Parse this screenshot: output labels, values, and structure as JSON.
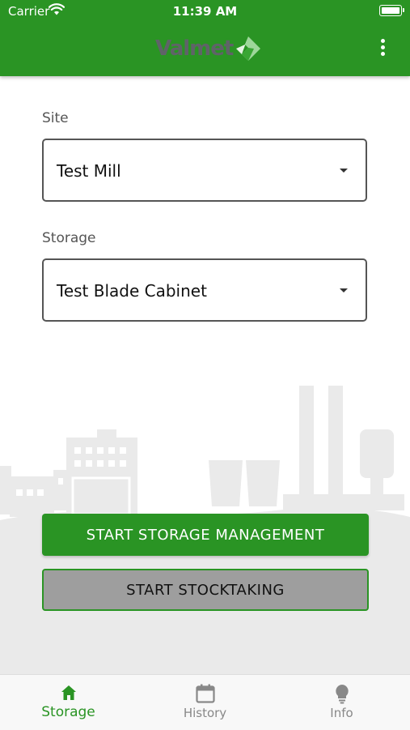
{
  "status_bar": {
    "carrier": "Carrier",
    "time": "11:39 AM",
    "icons": [
      "wifi-icon",
      "battery-icon"
    ]
  },
  "header": {
    "logo_text": "Valmet",
    "brand_color": "#2a9424",
    "menu_icon": "more-vertical-icon"
  },
  "form": {
    "site": {
      "label": "Site",
      "value": "Test Mill"
    },
    "storage": {
      "label": "Storage",
      "value": "Test Blade Cabinet"
    }
  },
  "actions": {
    "primary": "START STORAGE MANAGEMENT",
    "secondary": "START STOCKTAKING"
  },
  "tabbar": {
    "items": [
      {
        "label": "Storage",
        "icon": "home-icon",
        "active": true
      },
      {
        "label": "History",
        "icon": "calendar-icon",
        "active": false
      },
      {
        "label": "Info",
        "icon": "lightbulb-icon",
        "active": false
      }
    ]
  }
}
